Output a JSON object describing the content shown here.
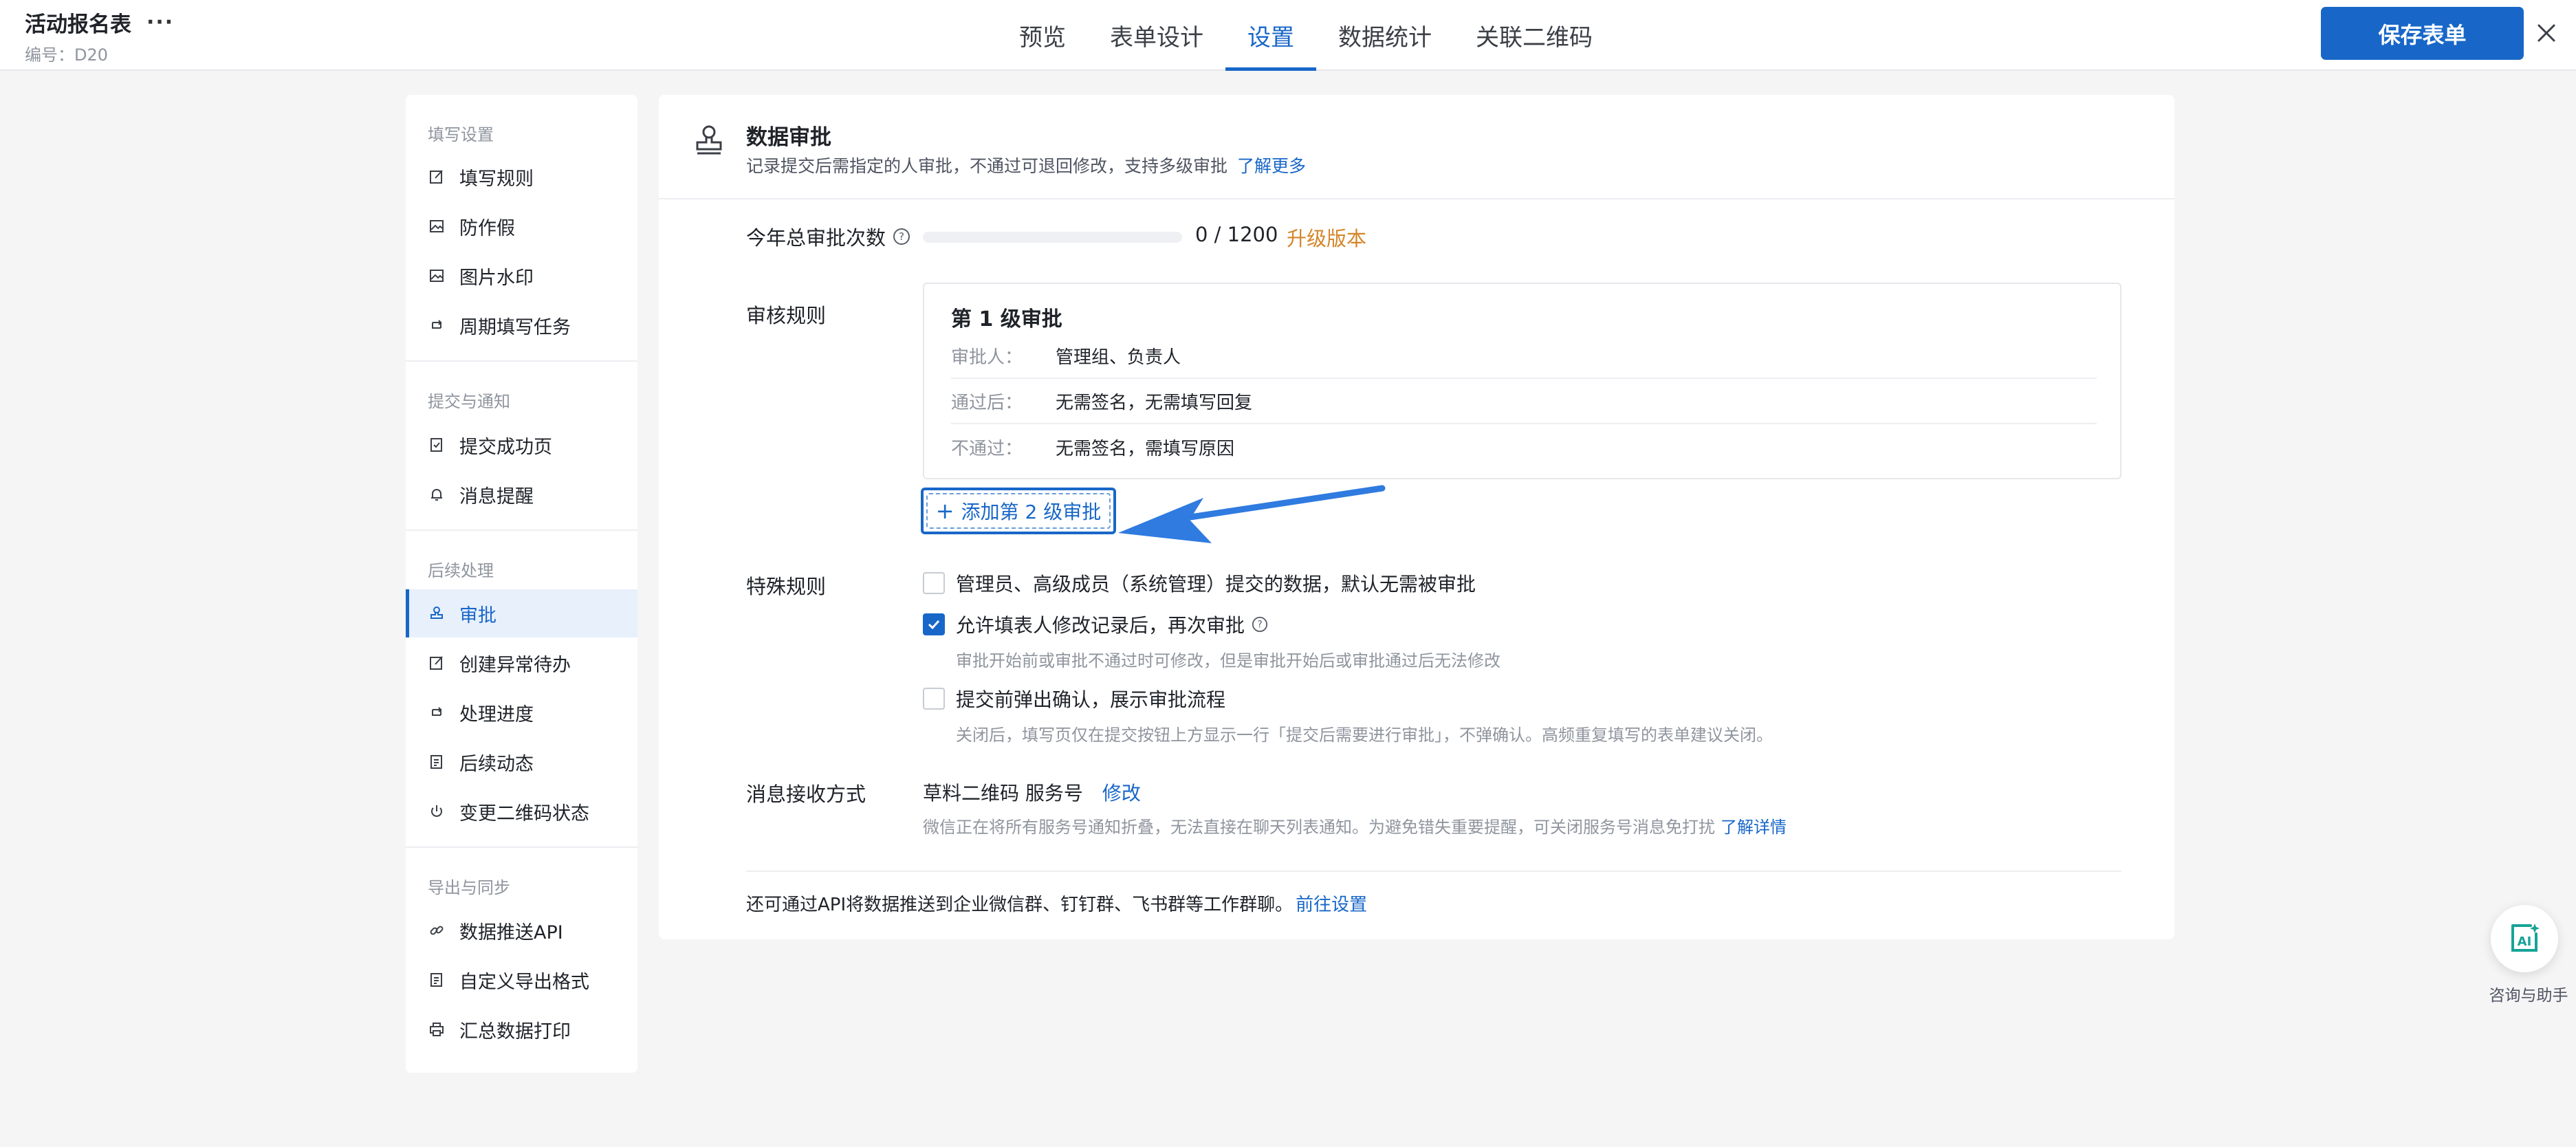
{
  "header": {
    "form_title": "活动报名表",
    "more": "···",
    "form_code": "编号：D20",
    "tabs": [
      {
        "label": "预览",
        "active": false
      },
      {
        "label": "表单设计",
        "active": false
      },
      {
        "label": "设置",
        "active": true
      },
      {
        "label": "数据统计",
        "active": false
      },
      {
        "label": "关联二维码",
        "active": false
      }
    ],
    "save_label": "保存表单",
    "accent_color": "#1867c8"
  },
  "sidebar": {
    "groups": [
      {
        "title": "填写设置",
        "items": [
          {
            "label": "填写规则",
            "icon": "edit-icon"
          },
          {
            "label": "防作假",
            "icon": "image-icon"
          },
          {
            "label": "图片水印",
            "icon": "image-icon"
          },
          {
            "label": "周期填写任务",
            "icon": "cycle-icon"
          }
        ]
      },
      {
        "title": "提交与通知",
        "items": [
          {
            "label": "提交成功页",
            "icon": "doc-check-icon"
          },
          {
            "label": "消息提醒",
            "icon": "bell-icon"
          }
        ]
      },
      {
        "title": "后续处理",
        "items": [
          {
            "label": "审批",
            "icon": "stamp-icon",
            "active": true
          },
          {
            "label": "创建异常待办",
            "icon": "edit-icon"
          },
          {
            "label": "处理进度",
            "icon": "cycle-icon"
          },
          {
            "label": "后续动态",
            "icon": "doc-icon"
          },
          {
            "label": "变更二维码状态",
            "icon": "power-icon"
          }
        ]
      },
      {
        "title": "导出与同步",
        "items": [
          {
            "label": "数据推送API",
            "icon": "link-icon"
          },
          {
            "label": "自定义导出格式",
            "icon": "doc-icon"
          },
          {
            "label": "汇总数据打印",
            "icon": "printer-icon"
          }
        ]
      }
    ]
  },
  "main": {
    "section_title": "数据审批",
    "section_desc": "记录提交后需指定的人审批，不通过可退回修改，支持多级审批",
    "learn_more": "了解更多",
    "quota": {
      "label": "今年总审批次数",
      "used": 0,
      "total": 1200,
      "text": "0 / 1200",
      "upgrade": "升级版本",
      "upgrade_color": "#d4862a"
    },
    "rules": {
      "label": "审核规则",
      "level_title": "第 1 级审批",
      "rows": [
        {
          "key": "审批人：",
          "value": "管理组、负责人"
        },
        {
          "key": "通过后：",
          "value": "无需签名，无需填写回复"
        },
        {
          "key": "不通过：",
          "value": "无需签名，需填写原因"
        }
      ],
      "add_level": "添加第 2 级审批"
    },
    "special": {
      "label": "特殊规则",
      "options": [
        {
          "label": "管理员、高级成员（系统管理）提交的数据，默认无需被审批",
          "checked": false,
          "hint": ""
        },
        {
          "label": "允许填表人修改记录后，再次审批",
          "checked": true,
          "hint": "审批开始前或审批不通过时可修改，但是审批开始后或审批通过后无法修改"
        },
        {
          "label": "提交前弹出确认，展示审批流程",
          "checked": false,
          "hint": "关闭后，填写页仅在提交按钮上方显示一行「提交后需要进行审批」，不弹确认。高频重复填写的表单建议关闭。"
        }
      ]
    },
    "message": {
      "label": "消息接收方式",
      "value": "草料二维码 服务号",
      "modify": "修改",
      "hint": "微信正在将所有服务号通知折叠，无法直接在聊天列表通知。为避免错失重要提醒，可关闭服务号消息免打扰",
      "hint_link": "了解详情"
    },
    "footer": {
      "text": "还可通过API将数据推送到企业微信群、钉钉群、飞书群等工作群聊。",
      "link": "前往设置"
    }
  },
  "assistant": {
    "label": "咨询与助手"
  }
}
